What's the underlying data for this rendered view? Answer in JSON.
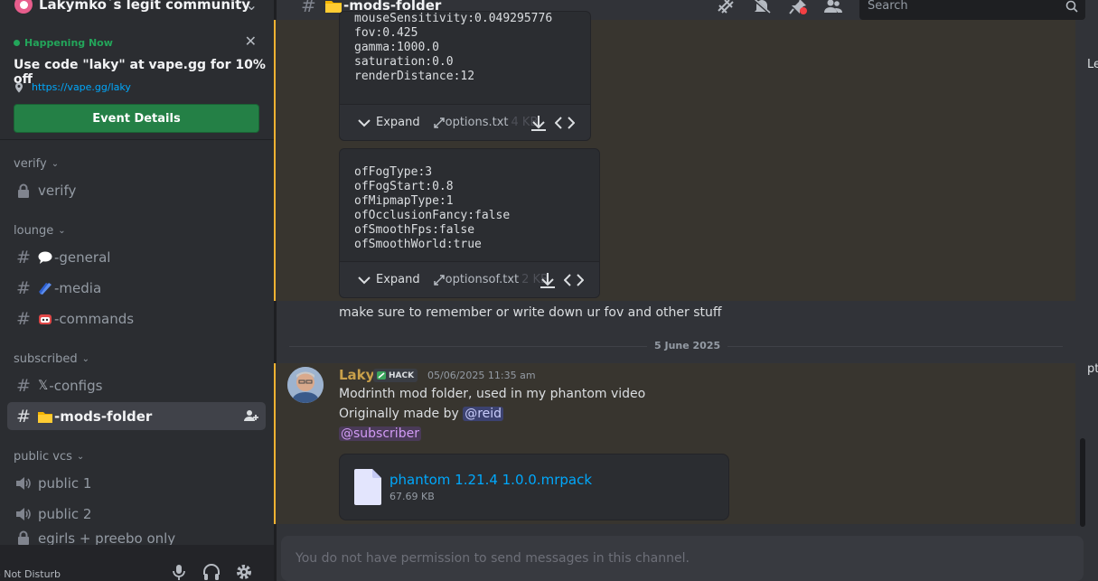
{
  "server": {
    "name": "Lakymko`s legit community"
  },
  "event": {
    "status": "Happening Now",
    "title": "Use code \"laky\" at vape.gg for 10% off",
    "link": "https://vape.gg/laky",
    "button": "Event Details"
  },
  "categories": {
    "verify": "verify",
    "lounge": "lounge",
    "subscribed": "subscribed",
    "public_vcs": "public vcs"
  },
  "channels": {
    "verify": "verify",
    "general": "-general",
    "media": "-media",
    "commands": "-commands",
    "configs": "-configs",
    "mods_folder": "-mods-folder",
    "public1": "public 1",
    "public2": "public 2",
    "egirls": "egirls + preebo only"
  },
  "user_panel": {
    "status": "o Not Disturb"
  },
  "topbar": {
    "title": "-mods-folder",
    "search_placeholder": "Search"
  },
  "code_block_1": {
    "lines": "mouseSensitivity:0.049295776\nfov:0.425\ngamma:1000.0\nsaturation:0.0\nrenderDistance:12",
    "expand": "Expand",
    "filename": "options.txt",
    "size": "4 KB"
  },
  "code_block_2": {
    "lines": "ofFogType:3\nofFogStart:0.8\nofMipmapType:1\nofOcclusionFancy:false\nofSmoothFps:false\nofSmoothWorld:true",
    "expand": "Expand",
    "filename": "optionsof.txt",
    "size": "2 KB"
  },
  "message_prev": {
    "text": "make sure to remember or write down ur fov and other stuff"
  },
  "date_divider": "5 June 2025",
  "message": {
    "author": "Laky",
    "tag": "HACK",
    "timestamp": "05/06/2025 11:35 am",
    "line1": "Modrinth mod folder, used in my phantom video",
    "line2_prefix": "Originally made by ",
    "mention_user": "@reid",
    "mention_role": "@subscriber",
    "attachment": {
      "name": "phantom 1.21.4 1.0.0.mrpack",
      "size": "67.69 KB"
    }
  },
  "composer": {
    "placeholder": "You do not have permission to send messages in this channel."
  },
  "edge": {
    "top": "Le",
    "mid": "pt"
  },
  "colors": {
    "accent_green": "#248046",
    "link": "#00a8fc",
    "highlight_border": "#f0b232",
    "author": "#c9a04a"
  }
}
